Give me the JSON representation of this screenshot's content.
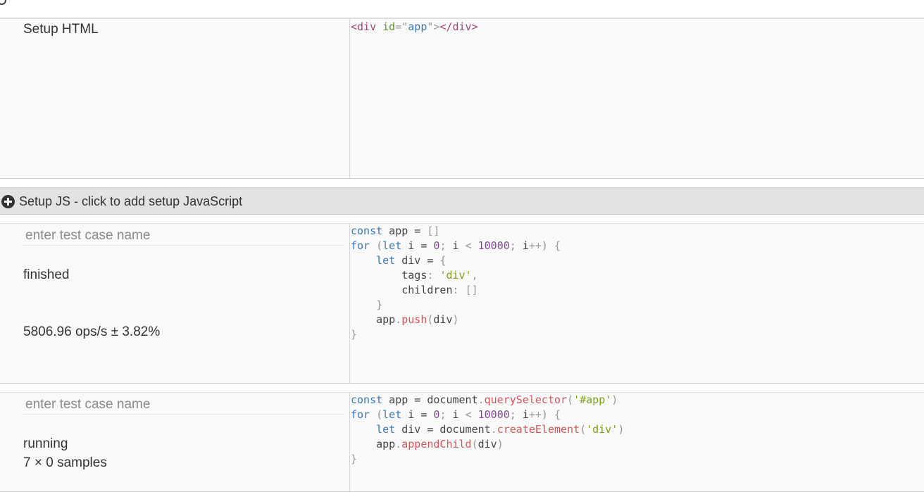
{
  "setup_html": {
    "label": "Setup HTML",
    "code": {
      "tag_open": "<div",
      "attr": "id",
      "eq": "=\"",
      "value": "app",
      "close_q": "\">",
      "tag_close": "</div>"
    }
  },
  "setup_js": {
    "label": "Setup JS - click to add setup JavaScript",
    "icon": "plus-circle-icon"
  },
  "test_case_1": {
    "name_placeholder": "enter test case name",
    "status": "finished",
    "result": "5806.96 ops/s ± 3.82%",
    "code_lines": [
      "const app = []",
      "for (let i = 0; i < 10000; i++) {",
      "    let div = {",
      "        tags: 'div',",
      "        children: []",
      "    }",
      "    app.push(div)",
      "}"
    ]
  },
  "test_case_2": {
    "name_placeholder": "enter test case name",
    "status": "running",
    "samples": "7 × 0 samples",
    "code_lines": [
      "const app = document.querySelector('#app')",
      "for (let i = 0; i < 10000; i++) {",
      "    let div = document.createElement('div')",
      "    app.appendChild(div)",
      "}"
    ]
  }
}
